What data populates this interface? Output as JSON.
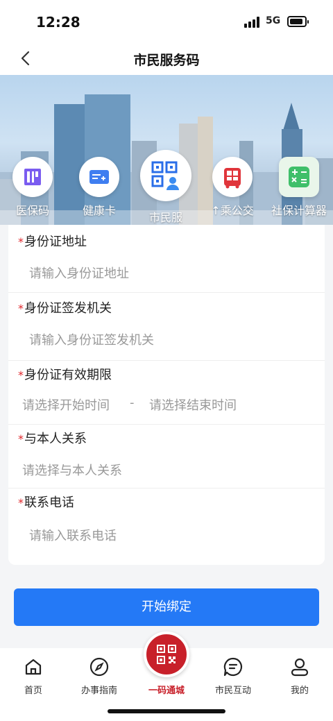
{
  "status_bar": {
    "time": "12:28",
    "network": "5G"
  },
  "nav": {
    "title": "市民服务码"
  },
  "services": [
    {
      "label": "医保码",
      "icon": "medical-insurance-code-icon"
    },
    {
      "label": "健康卡",
      "icon": "health-card-icon"
    },
    {
      "label": "市民服",
      "icon": "citizen-service-code-icon"
    },
    {
      "label": "↑乘公交",
      "icon": "bus-ride-icon"
    },
    {
      "label": "社保计算器",
      "icon": "social-security-calculator-icon"
    }
  ],
  "form": {
    "id_address": {
      "label": "身份证地址",
      "placeholder": "请输入身份证地址"
    },
    "id_issuer": {
      "label": "身份证签发机关",
      "placeholder": "请输入身份证签发机关"
    },
    "id_validity": {
      "label": "身份证有效期限",
      "start_placeholder": "请选择开始时间",
      "separator": "-",
      "end_placeholder": "请选择结束时间"
    },
    "relation": {
      "label": "与本人关系",
      "placeholder": "请选择与本人关系"
    },
    "phone": {
      "label": "联系电话",
      "placeholder": "请输入联系电话"
    },
    "required_mark": "*"
  },
  "submit_label": "开始绑定",
  "tabbar": [
    {
      "label": "首页",
      "icon": "home-icon"
    },
    {
      "label": "办事指南",
      "icon": "compass-icon"
    },
    {
      "label": "一码通城",
      "icon": "qr-code-icon"
    },
    {
      "label": "市民互动",
      "icon": "chat-icon"
    },
    {
      "label": "我的",
      "icon": "user-icon"
    }
  ],
  "colors": {
    "primary": "#2479f6",
    "accent_red": "#c8202a",
    "required": "#e0262b"
  }
}
